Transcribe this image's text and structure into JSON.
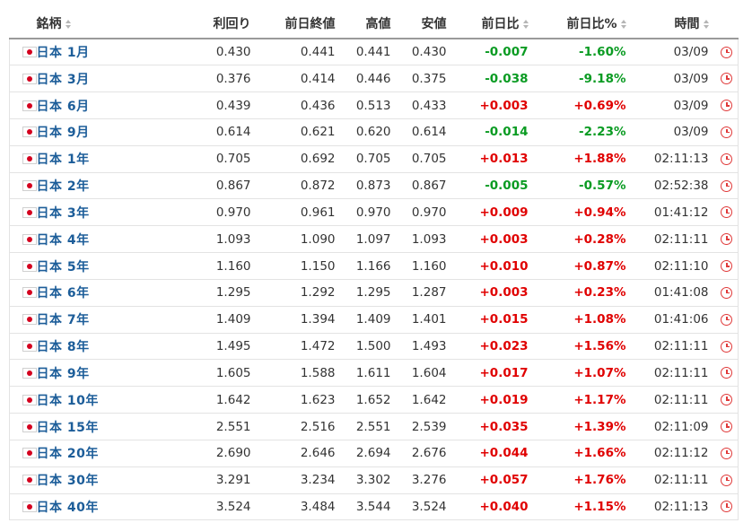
{
  "headers": {
    "name": "銘柄",
    "yield": "利回り",
    "prev": "前日終値",
    "high": "高値",
    "low": "安値",
    "change": "前日比",
    "change_pct": "前日比%",
    "time": "時間"
  },
  "colors": {
    "positive": "#e00000",
    "negative": "#0a9b22",
    "link": "#1c5d99",
    "clock_icon": "#e03a3a"
  },
  "icons": {
    "flag": "japan-flag-icon",
    "row_action": "clock-icon",
    "sort": "sort-arrows-icon"
  },
  "rows": [
    {
      "name": "日本 1月",
      "yield": "0.430",
      "prev": "0.441",
      "high": "0.441",
      "low": "0.430",
      "change": "-0.007",
      "change_pct": "-1.60%",
      "time": "03/09",
      "dir": "neg"
    },
    {
      "name": "日本 3月",
      "yield": "0.376",
      "prev": "0.414",
      "high": "0.446",
      "low": "0.375",
      "change": "-0.038",
      "change_pct": "-9.18%",
      "time": "03/09",
      "dir": "neg"
    },
    {
      "name": "日本 6月",
      "yield": "0.439",
      "prev": "0.436",
      "high": "0.513",
      "low": "0.433",
      "change": "+0.003",
      "change_pct": "+0.69%",
      "time": "03/09",
      "dir": "pos"
    },
    {
      "name": "日本 9月",
      "yield": "0.614",
      "prev": "0.621",
      "high": "0.620",
      "low": "0.614",
      "change": "-0.014",
      "change_pct": "-2.23%",
      "time": "03/09",
      "dir": "neg"
    },
    {
      "name": "日本 1年",
      "yield": "0.705",
      "prev": "0.692",
      "high": "0.705",
      "low": "0.705",
      "change": "+0.013",
      "change_pct": "+1.88%",
      "time": "02:11:13",
      "dir": "pos"
    },
    {
      "name": "日本 2年",
      "yield": "0.867",
      "prev": "0.872",
      "high": "0.873",
      "low": "0.867",
      "change": "-0.005",
      "change_pct": "-0.57%",
      "time": "02:52:38",
      "dir": "neg"
    },
    {
      "name": "日本 3年",
      "yield": "0.970",
      "prev": "0.961",
      "high": "0.970",
      "low": "0.970",
      "change": "+0.009",
      "change_pct": "+0.94%",
      "time": "01:41:12",
      "dir": "pos"
    },
    {
      "name": "日本 4年",
      "yield": "1.093",
      "prev": "1.090",
      "high": "1.097",
      "low": "1.093",
      "change": "+0.003",
      "change_pct": "+0.28%",
      "time": "02:11:11",
      "dir": "pos"
    },
    {
      "name": "日本 5年",
      "yield": "1.160",
      "prev": "1.150",
      "high": "1.166",
      "low": "1.160",
      "change": "+0.010",
      "change_pct": "+0.87%",
      "time": "02:11:10",
      "dir": "pos"
    },
    {
      "name": "日本 6年",
      "yield": "1.295",
      "prev": "1.292",
      "high": "1.295",
      "low": "1.287",
      "change": "+0.003",
      "change_pct": "+0.23%",
      "time": "01:41:08",
      "dir": "pos"
    },
    {
      "name": "日本 7年",
      "yield": "1.409",
      "prev": "1.394",
      "high": "1.409",
      "low": "1.401",
      "change": "+0.015",
      "change_pct": "+1.08%",
      "time": "01:41:06",
      "dir": "pos"
    },
    {
      "name": "日本 8年",
      "yield": "1.495",
      "prev": "1.472",
      "high": "1.500",
      "low": "1.493",
      "change": "+0.023",
      "change_pct": "+1.56%",
      "time": "02:11:11",
      "dir": "pos"
    },
    {
      "name": "日本 9年",
      "yield": "1.605",
      "prev": "1.588",
      "high": "1.611",
      "low": "1.604",
      "change": "+0.017",
      "change_pct": "+1.07%",
      "time": "02:11:11",
      "dir": "pos"
    },
    {
      "name": "日本 10年",
      "yield": "1.642",
      "prev": "1.623",
      "high": "1.652",
      "low": "1.642",
      "change": "+0.019",
      "change_pct": "+1.17%",
      "time": "02:11:11",
      "dir": "pos"
    },
    {
      "name": "日本 15年",
      "yield": "2.551",
      "prev": "2.516",
      "high": "2.551",
      "low": "2.539",
      "change": "+0.035",
      "change_pct": "+1.39%",
      "time": "02:11:09",
      "dir": "pos"
    },
    {
      "name": "日本 20年",
      "yield": "2.690",
      "prev": "2.646",
      "high": "2.694",
      "low": "2.676",
      "change": "+0.044",
      "change_pct": "+1.66%",
      "time": "02:11:12",
      "dir": "pos"
    },
    {
      "name": "日本 30年",
      "yield": "3.291",
      "prev": "3.234",
      "high": "3.302",
      "low": "3.276",
      "change": "+0.057",
      "change_pct": "+1.76%",
      "time": "02:11:11",
      "dir": "pos"
    },
    {
      "name": "日本 40年",
      "yield": "3.524",
      "prev": "3.484",
      "high": "3.544",
      "low": "3.524",
      "change": "+0.040",
      "change_pct": "+1.15%",
      "time": "02:11:13",
      "dir": "pos"
    }
  ]
}
